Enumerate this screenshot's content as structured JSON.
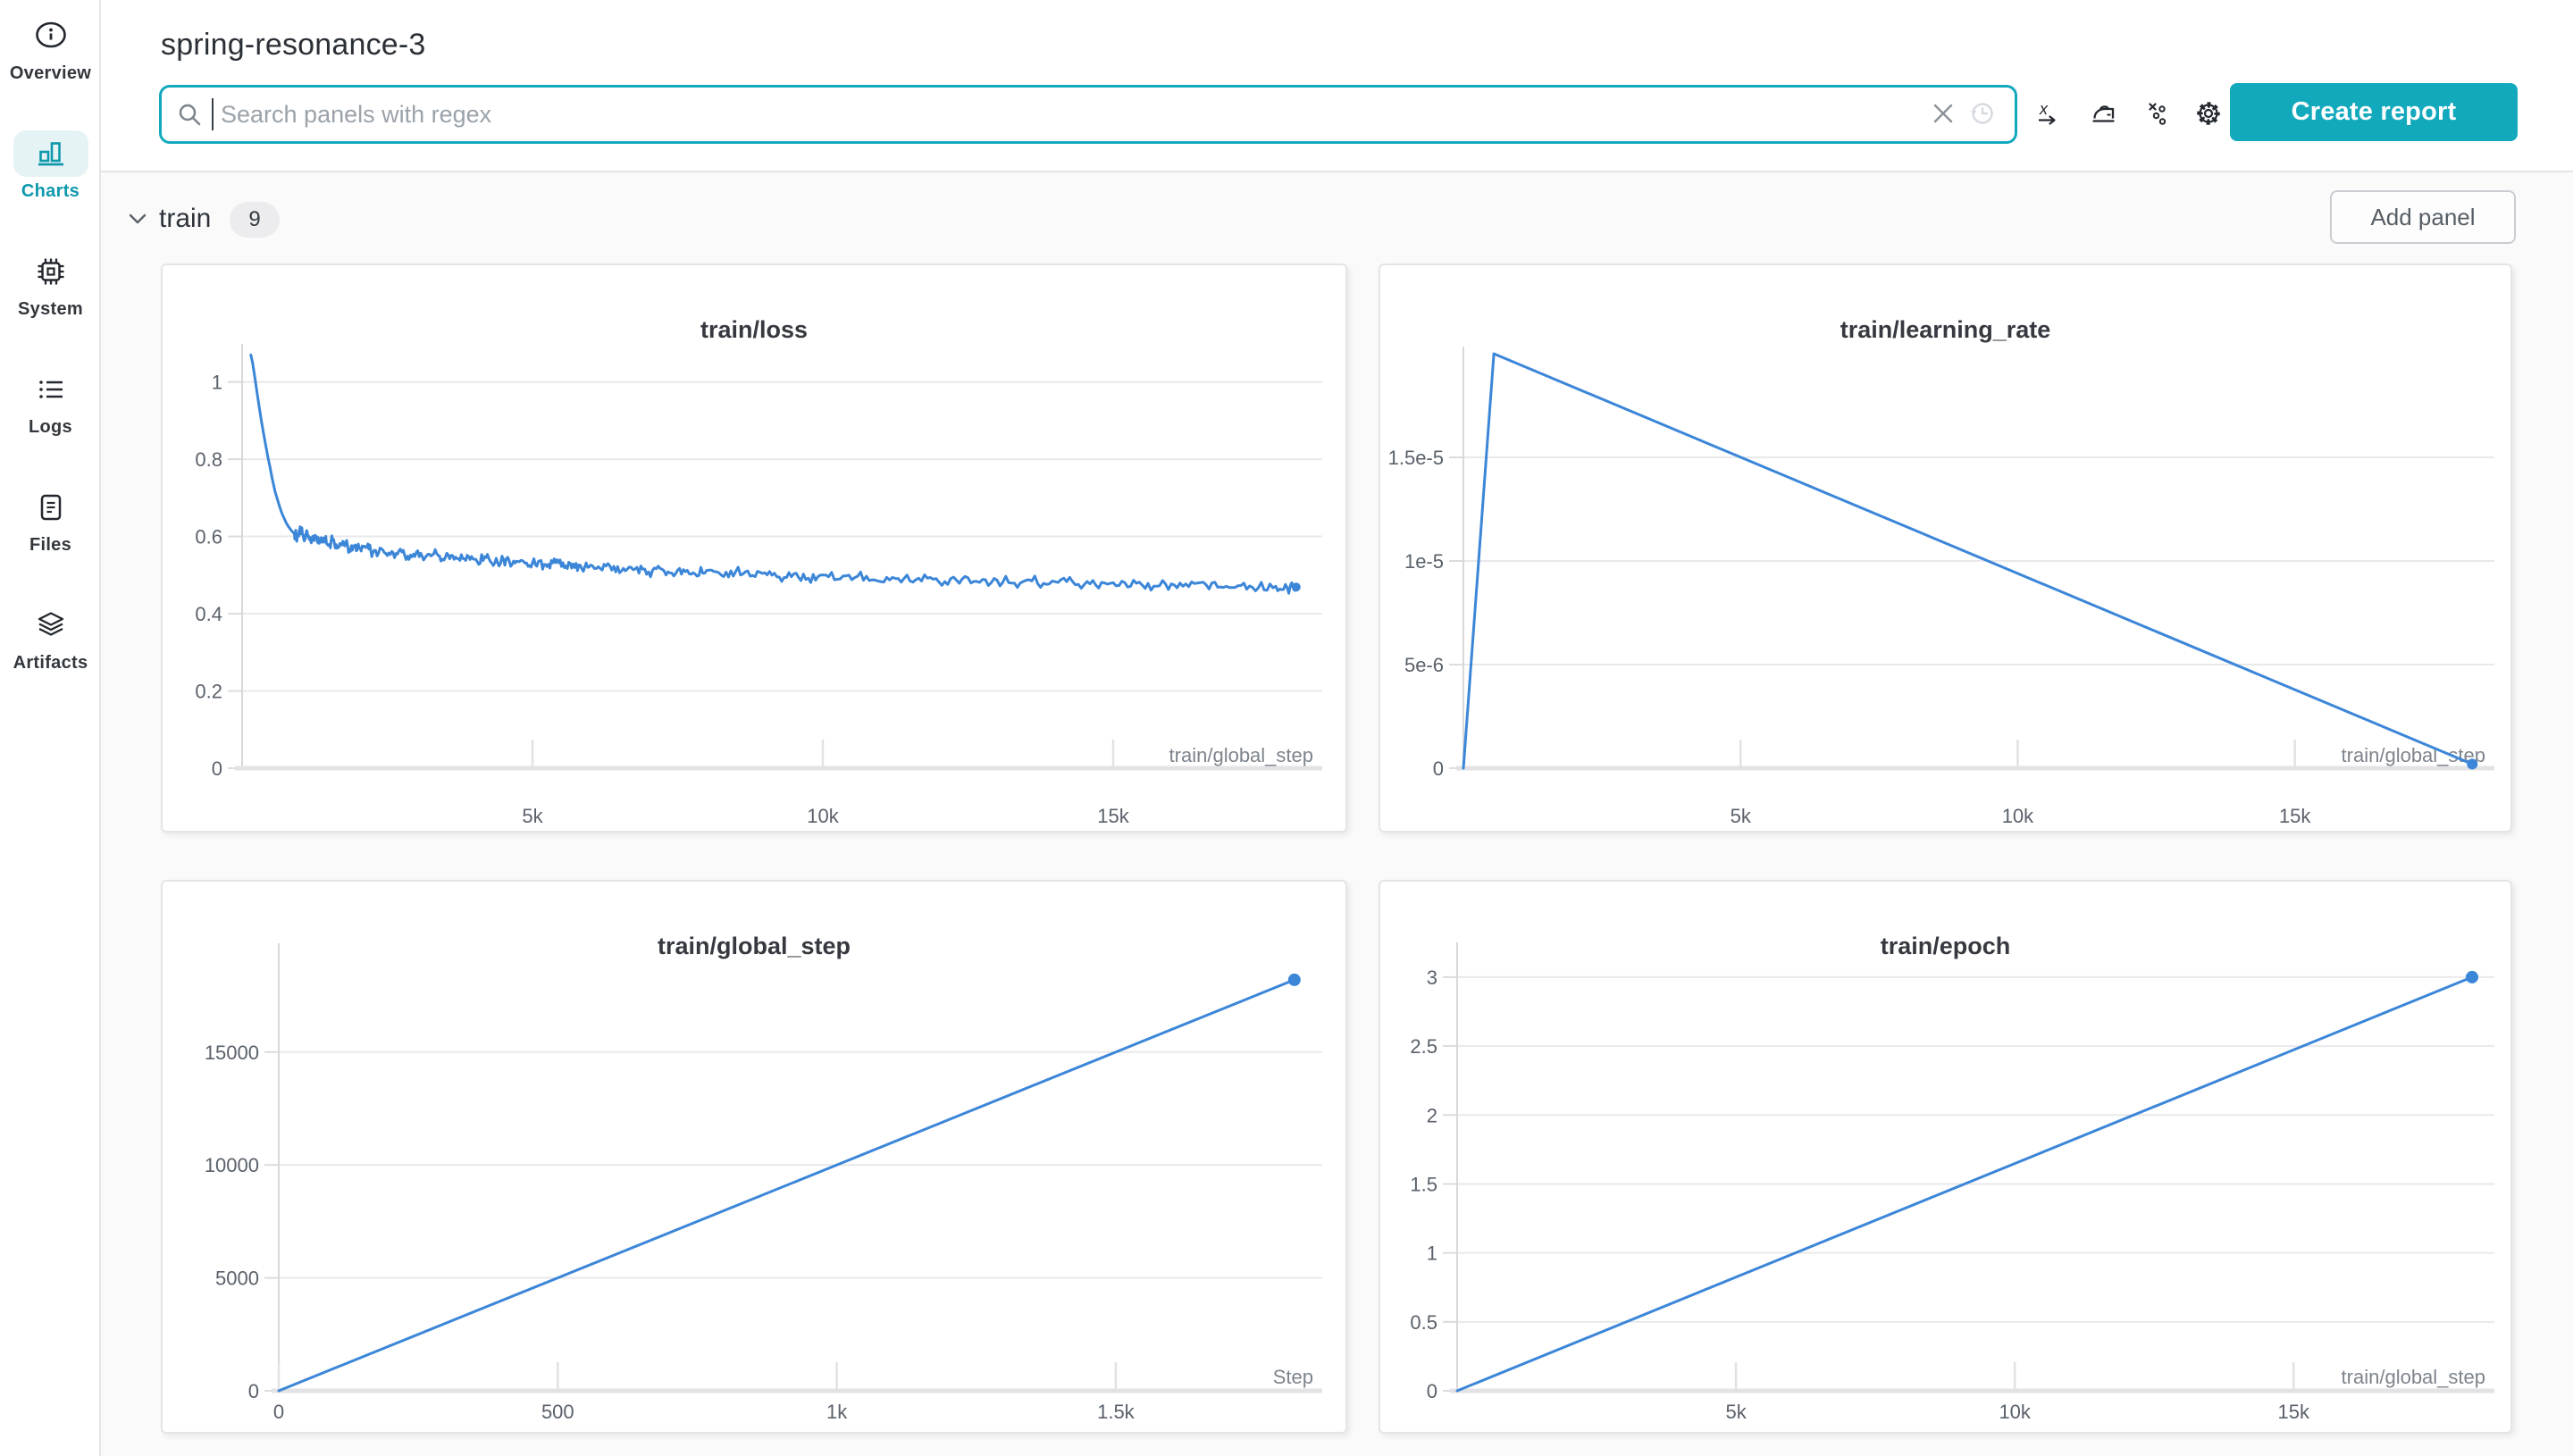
{
  "page": {
    "title": "spring-resonance-3"
  },
  "colors": {
    "accent": "#13a9bd",
    "accent_dark": "#0e98ac",
    "line_blue": "#3c86d8",
    "panel_bg": "#ffffff",
    "page_bg": "#fafafa"
  },
  "sidebar": {
    "items": [
      {
        "id": "overview",
        "label": "Overview",
        "icon": "info-icon",
        "active": false
      },
      {
        "id": "charts",
        "label": "Charts",
        "icon": "bar-chart-icon",
        "active": true
      },
      {
        "id": "system",
        "label": "System",
        "icon": "cpu-icon",
        "active": false
      },
      {
        "id": "logs",
        "label": "Logs",
        "icon": "list-icon",
        "active": false
      },
      {
        "id": "files",
        "label": "Files",
        "icon": "file-icon",
        "active": false
      },
      {
        "id": "artifacts",
        "label": "Artifacts",
        "icon": "layers-icon",
        "active": false
      }
    ]
  },
  "toolbar": {
    "search_placeholder": "Search panels with regex",
    "search_value": "",
    "search_icon": "search-icon",
    "clear_icon": "clear-icon",
    "history_icon": "history-icon",
    "icons": [
      {
        "id": "x-axis-settings",
        "icon": "x-axis-icon"
      },
      {
        "id": "smoothing",
        "icon": "iron-icon"
      },
      {
        "id": "outliers",
        "icon": "outliers-icon"
      },
      {
        "id": "panel-settings",
        "icon": "gear-icon"
      }
    ],
    "create_report_label": "Create report"
  },
  "section": {
    "name": "train",
    "count": "9",
    "add_panel_label": "Add panel",
    "chevron_icon": "chevron-down-icon"
  },
  "chart_data": [
    {
      "type": "line",
      "title": "train/loss",
      "xlabel": "train/global_step",
      "xlim": [
        0,
        18600
      ],
      "ylim": [
        0,
        1.08
      ],
      "x_ticks": [
        {
          "v": 5000,
          "label": "5k"
        },
        {
          "v": 10000,
          "label": "10k"
        },
        {
          "v": 15000,
          "label": "15k"
        }
      ],
      "y_ticks": [
        {
          "v": 0,
          "label": "0"
        },
        {
          "v": 0.2,
          "label": "0.2"
        },
        {
          "v": 0.4,
          "label": "0.4"
        },
        {
          "v": 0.6,
          "label": "0.6"
        },
        {
          "v": 0.8,
          "label": "0.8"
        },
        {
          "v": 1,
          "label": "1"
        }
      ],
      "grid": true,
      "legend": "none",
      "end_dot_r": 5,
      "noise": {
        "amp": 0.014,
        "from": 900,
        "subdiv": 6
      },
      "series": [
        {
          "name": "spring-resonance-3",
          "points": [
            [
              150,
              1.07
            ],
            [
              180,
              1.05
            ],
            [
              210,
              1.02
            ],
            [
              240,
              0.99
            ],
            [
              270,
              0.96
            ],
            [
              300,
              0.93
            ],
            [
              330,
              0.9
            ],
            [
              360,
              0.875
            ],
            [
              390,
              0.85
            ],
            [
              420,
              0.825
            ],
            [
              450,
              0.8
            ],
            [
              480,
              0.78
            ],
            [
              510,
              0.755
            ],
            [
              540,
              0.735
            ],
            [
              570,
              0.715
            ],
            [
              600,
              0.7
            ],
            [
              640,
              0.68
            ],
            [
              680,
              0.662
            ],
            [
              720,
              0.648
            ],
            [
              760,
              0.635
            ],
            [
              800,
              0.625
            ],
            [
              850,
              0.615
            ],
            [
              900,
              0.607
            ],
            [
              950,
              0.6
            ],
            [
              1000,
              0.625
            ],
            [
              1060,
              0.594
            ],
            [
              1120,
              0.612
            ],
            [
              1180,
              0.588
            ],
            [
              1250,
              0.603
            ],
            [
              1320,
              0.582
            ],
            [
              1400,
              0.596
            ],
            [
              1480,
              0.577
            ],
            [
              1560,
              0.59
            ],
            [
              1650,
              0.572
            ],
            [
              1750,
              0.585
            ],
            [
              1850,
              0.567
            ],
            [
              1950,
              0.578
            ],
            [
              2050,
              0.562
            ],
            [
              2150,
              0.573
            ],
            [
              2250,
              0.558
            ],
            [
              2400,
              0.568
            ],
            [
              2550,
              0.553
            ],
            [
              2700,
              0.563
            ],
            [
              2850,
              0.549
            ],
            [
              3000,
              0.559
            ],
            [
              3150,
              0.545
            ],
            [
              3300,
              0.555
            ],
            [
              3450,
              0.541
            ],
            [
              3600,
              0.551
            ],
            [
              3750,
              0.538
            ],
            [
              3900,
              0.548
            ],
            [
              4050,
              0.534
            ],
            [
              4200,
              0.545
            ],
            [
              4350,
              0.531
            ],
            [
              4500,
              0.541
            ],
            [
              4650,
              0.528
            ],
            [
              4800,
              0.538
            ],
            [
              4950,
              0.525
            ],
            [
              5100,
              0.535
            ],
            [
              5250,
              0.522
            ],
            [
              5400,
              0.532
            ],
            [
              5550,
              0.519
            ],
            [
              5700,
              0.529
            ],
            [
              5850,
              0.516
            ],
            [
              6000,
              0.526
            ],
            [
              6200,
              0.513
            ],
            [
              6400,
              0.523
            ],
            [
              6600,
              0.511
            ],
            [
              6800,
              0.52
            ],
            [
              7000,
              0.508
            ],
            [
              7200,
              0.517
            ],
            [
              7400,
              0.505
            ],
            [
              7600,
              0.514
            ],
            [
              7800,
              0.503
            ],
            [
              8000,
              0.512
            ],
            [
              8250,
              0.5
            ],
            [
              8500,
              0.509
            ],
            [
              8750,
              0.497
            ],
            [
              9000,
              0.506
            ],
            [
              9250,
              0.495
            ],
            [
              9500,
              0.503
            ],
            [
              9750,
              0.492
            ],
            [
              10000,
              0.5
            ],
            [
              10300,
              0.49
            ],
            [
              10600,
              0.497
            ],
            [
              10900,
              0.487
            ],
            [
              11200,
              0.494
            ],
            [
              11500,
              0.485
            ],
            [
              11800,
              0.492
            ],
            [
              12100,
              0.483
            ],
            [
              12400,
              0.49
            ],
            [
              12700,
              0.481
            ],
            [
              13000,
              0.487
            ],
            [
              13300,
              0.479
            ],
            [
              13600,
              0.485
            ],
            [
              13900,
              0.477
            ],
            [
              14200,
              0.483
            ],
            [
              14500,
              0.475
            ],
            [
              14800,
              0.481
            ],
            [
              15100,
              0.473
            ],
            [
              15400,
              0.479
            ],
            [
              15700,
              0.471
            ],
            [
              16000,
              0.477
            ],
            [
              16300,
              0.47
            ],
            [
              16600,
              0.475
            ],
            [
              16900,
              0.468
            ],
            [
              17200,
              0.473
            ],
            [
              17500,
              0.467
            ],
            [
              17800,
              0.471
            ],
            [
              18000,
              0.466
            ],
            [
              18150,
              0.469
            ]
          ]
        }
      ],
      "layout": {
        "plot": {
          "l": 89,
          "t": 96,
          "r": 1298,
          "b": 563
        },
        "x_tick_label_y": 624,
        "xlabel_y": 556
      }
    },
    {
      "type": "line",
      "title": "train/learning_rate",
      "xlabel": "train/global_step",
      "xlim": [
        0,
        18600
      ],
      "ylim": [
        0,
        2e-05
      ],
      "x_ticks": [
        {
          "v": 5000,
          "label": "5k"
        },
        {
          "v": 10000,
          "label": "10k"
        },
        {
          "v": 15000,
          "label": "15k"
        }
      ],
      "y_ticks": [
        {
          "v": 0,
          "label": "0"
        },
        {
          "v": 5e-06,
          "label": "5e-6"
        },
        {
          "v": 1e-05,
          "label": "1e-5"
        },
        {
          "v": 1.5e-05,
          "label": "1.5e-5"
        }
      ],
      "grid": true,
      "legend": "none",
      "end_dot_r": 6,
      "series": [
        {
          "name": "spring-resonance-3",
          "points": [
            [
              0,
              0
            ],
            [
              550,
              2e-05
            ],
            [
              18200,
              2e-07
            ]
          ]
        }
      ],
      "layout": {
        "plot": {
          "l": 93,
          "t": 99,
          "r": 1247,
          "b": 563
        },
        "x_tick_label_y": 624,
        "xlabel_y": 556
      }
    },
    {
      "type": "line",
      "title": "train/global_step",
      "xlabel": "Step",
      "xlim": [
        0,
        1870
      ],
      "ylim": [
        0,
        19500
      ],
      "x_ticks": [
        {
          "v": 0,
          "label": "0"
        },
        {
          "v": 500,
          "label": "500"
        },
        {
          "v": 1000,
          "label": "1k"
        },
        {
          "v": 1500,
          "label": "1.5k"
        }
      ],
      "y_ticks": [
        {
          "v": 0,
          "label": "0"
        },
        {
          "v": 5000,
          "label": "5000"
        },
        {
          "v": 10000,
          "label": "10000"
        },
        {
          "v": 15000,
          "label": "15000"
        }
      ],
      "grid": true,
      "legend": "none",
      "end_dot_r": 7,
      "series": [
        {
          "name": "spring-resonance-3",
          "points": [
            [
              0,
              0
            ],
            [
              1820,
              18200
            ]
          ]
        }
      ],
      "layout": {
        "plot": {
          "l": 130,
          "t": 77,
          "r": 1298,
          "b": 570
        },
        "x_tick_label_y": 601,
        "xlabel_y": 562
      }
    },
    {
      "type": "line",
      "title": "train/epoch",
      "xlabel": "train/global_step",
      "xlim": [
        0,
        18600
      ],
      "ylim": [
        0,
        3.2
      ],
      "x_ticks": [
        {
          "v": 5000,
          "label": "5k"
        },
        {
          "v": 10000,
          "label": "10k"
        },
        {
          "v": 15000,
          "label": "15k"
        }
      ],
      "y_ticks": [
        {
          "v": 0,
          "label": "0"
        },
        {
          "v": 0.5,
          "label": "0.5"
        },
        {
          "v": 1,
          "label": "1"
        },
        {
          "v": 1.5,
          "label": "1.5"
        },
        {
          "v": 2,
          "label": "2"
        },
        {
          "v": 2.5,
          "label": "2.5"
        },
        {
          "v": 3,
          "label": "3"
        }
      ],
      "grid": true,
      "legend": "none",
      "end_dot_r": 7,
      "series": [
        {
          "name": "spring-resonance-3",
          "points": [
            [
              0,
              0
            ],
            [
              18200,
              3
            ]
          ]
        }
      ],
      "layout": {
        "plot": {
          "l": 86,
          "t": 76,
          "r": 1247,
          "b": 570
        },
        "x_tick_label_y": 601,
        "xlabel_y": 562
      }
    }
  ]
}
